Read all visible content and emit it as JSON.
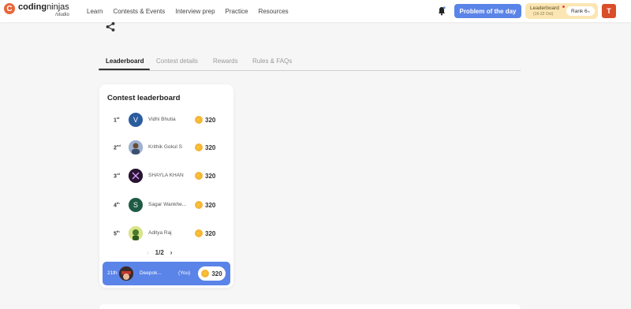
{
  "brand": {
    "name_bold": "coding",
    "name_light": "ninjas",
    "sub": "/studio",
    "logo_letter": "C"
  },
  "nav": {
    "links": [
      "Learn",
      "Contests & Events",
      "Interview prep",
      "Practice",
      "Resources"
    ]
  },
  "header": {
    "potd_label": "Problem of the day",
    "leaderboard_label": "Leaderboard",
    "leaderboard_dates": "(16-22 Oct)",
    "rank_label": "Rank",
    "rank_value": "6",
    "rank_suffix": "th",
    "avatar_letter": "T"
  },
  "tabs": [
    "Leaderboard",
    "Contest details",
    "Rewards",
    "Rules & FAQs"
  ],
  "active_tab": "Leaderboard",
  "leaderboard": {
    "title": "Contest leaderboard",
    "rows": [
      {
        "rank": "1",
        "suffix": "st",
        "name": "Vidhi Bhutia",
        "points": "320",
        "avatar_letter": "V",
        "avatar_color": "#2b5c9e"
      },
      {
        "rank": "2",
        "suffix": "nd",
        "name": "Krithik Gokul S",
        "points": "320",
        "avatar_letter": "",
        "avatar_color": "#8fa7c9"
      },
      {
        "rank": "3",
        "suffix": "rd",
        "name": "SHAYLA KHAN",
        "points": "320",
        "avatar_letter": "",
        "avatar_color": "#2a1433"
      },
      {
        "rank": "4",
        "suffix": "th",
        "name": "Sagar Wankhe...",
        "points": "320",
        "avatar_letter": "S",
        "avatar_color": "#1f5a45"
      },
      {
        "rank": "5",
        "suffix": "th",
        "name": "Aditya Raj",
        "points": "320",
        "avatar_letter": "",
        "avatar_color": "#c7d96b"
      }
    ],
    "pager": {
      "prev": "‹",
      "current": "1/2",
      "next": "›"
    },
    "you": {
      "rank": "21th",
      "name": "Deepok...",
      "tag": "(You)",
      "points": "320"
    }
  },
  "colors": {
    "accent": "#5b84e8",
    "coin": "#f5b53b",
    "logo": "#e8663a",
    "avatar": "#d94e2a"
  }
}
